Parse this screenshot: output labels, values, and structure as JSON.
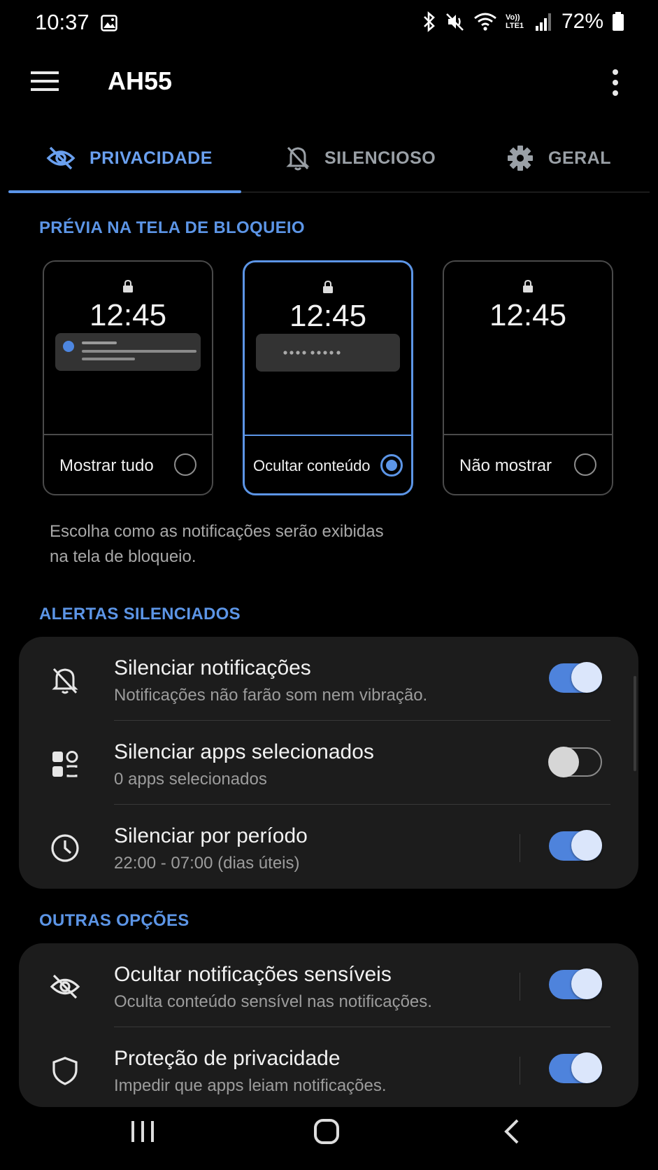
{
  "status_bar": {
    "time": "10:37",
    "network": "Vo)) LTE1",
    "battery": "72%"
  },
  "app_bar": {
    "title": "AH55"
  },
  "tabs": [
    {
      "label": "PRIVACIDADE",
      "icon": "eye-off-icon",
      "active": true
    },
    {
      "label": "SILENCIOSO",
      "icon": "bell-off-icon",
      "active": false
    },
    {
      "label": "GERAL",
      "icon": "gear-icon",
      "active": false
    }
  ],
  "lock_screen_preview": {
    "title": "PRÉVIA NA TELA DE BLOQUEIO",
    "options": [
      {
        "label": "Mostrar tudo",
        "time": "12:45",
        "selected": false
      },
      {
        "label": "Ocultar conteúdo",
        "time": "12:45",
        "selected": true
      },
      {
        "label": "Não mostrar",
        "time": "12:45",
        "selected": false
      }
    ],
    "helper_line1": "Escolha como as notificações serão exibidas",
    "helper_line2": "na tela de bloqueio."
  },
  "silenced_alerts": {
    "title": "ALERTAS SILENCIADOS",
    "items": [
      {
        "title": "Silenciar notificações",
        "subtitle": "Notificações não farão som nem vibração.",
        "icon": "bell-off-icon",
        "enabled": true
      },
      {
        "title": "Silenciar apps selecionados",
        "subtitle": "0 apps selecionados",
        "icon": "apps-icon",
        "enabled": false
      },
      {
        "title": "Silenciar por período",
        "subtitle": "22:00 - 07:00 (dias úteis)",
        "icon": "clock-icon",
        "enabled": true
      }
    ]
  },
  "other_options": {
    "title": "OUTRAS OPÇÕES",
    "items": [
      {
        "title": "Ocultar notificações sensíveis",
        "subtitle": "Oculta conteúdo sensível nas notificações.",
        "icon": "eye-off-icon",
        "enabled": true
      },
      {
        "title": "Proteção de privacidade",
        "subtitle": "Impedir que apps leiam notificações.",
        "icon": "shield-icon",
        "enabled": true
      }
    ]
  },
  "colors": {
    "accent": "#5c95e6",
    "toggle_on": "#4e83dc",
    "panel": "#1c1c1c",
    "background": "#000000"
  }
}
